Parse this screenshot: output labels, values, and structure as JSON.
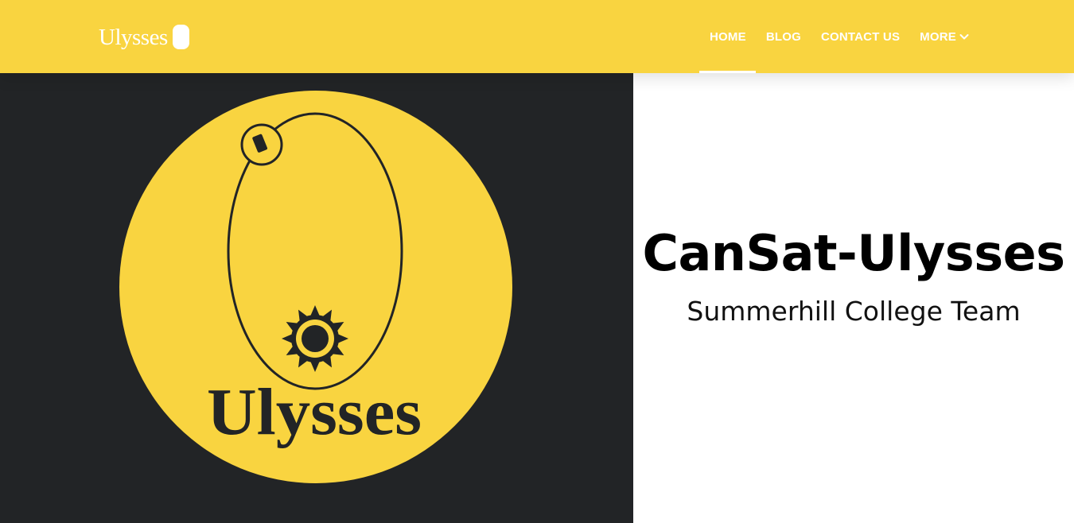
{
  "colors": {
    "brand_yellow": "#f9d440",
    "dark_background": "#222426",
    "nav_text": "#ffffff",
    "title_text": "#000000"
  },
  "navbar": {
    "brand": {
      "text": "Ulysses",
      "icon": "capsule-icon"
    },
    "links": [
      {
        "label": "HOME",
        "active": true
      },
      {
        "label": "BLOG",
        "active": false
      },
      {
        "label": "CONTACT US",
        "active": false
      },
      {
        "label": "MORE",
        "active": false,
        "icon": "chevron-down-icon"
      }
    ]
  },
  "hero": {
    "logo": {
      "text": "Ulysses",
      "icons": [
        "orbit-icon",
        "satellite-icon",
        "sun-icon"
      ]
    },
    "title": "CanSat-Ulysses",
    "subtitle": "Summerhill College Team"
  }
}
